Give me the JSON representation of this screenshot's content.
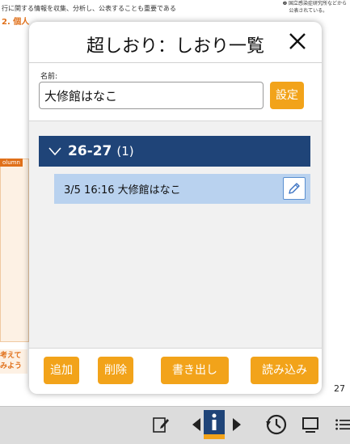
{
  "background": {
    "line1": "行に関する情報を収集、分析し、公表することも重要である",
    "line2_heading": "2. 個人",
    "right_note": "❷ 国立感染症研究所などから\n    公表されている。",
    "column_badge": "olumn",
    "think_label": "考えて\nみよう",
    "page_number": "27"
  },
  "dialog": {
    "title": "超しおり：しおり一覧",
    "close_icon": "close-icon",
    "name_label": "名前:",
    "name_value": "大修館はなこ",
    "set_label": "設定",
    "group": {
      "name": "26-27",
      "count": "(1)",
      "header_color": "#1f4478"
    },
    "items": [
      {
        "label": "3/5 16:16  大修館はなこ"
      }
    ],
    "buttons": {
      "add": "追加",
      "delete": "削除",
      "export": "書き出し",
      "import": "読み込み"
    },
    "accent_color": "#f2a31a"
  },
  "toolbar": {
    "icons": [
      "note-icon",
      "prev-page-icon",
      "info-icon",
      "next-page-icon",
      "history-icon",
      "window-icon",
      "menu-icon"
    ]
  }
}
